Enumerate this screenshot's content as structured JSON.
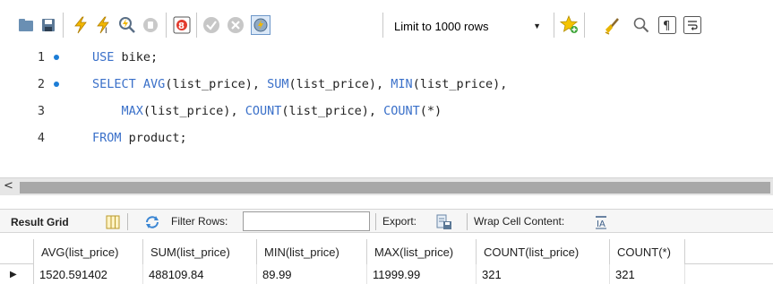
{
  "toolbar": {
    "icons": [
      "open-folder-icon",
      "save-icon",
      "execute-icon",
      "execute-current-icon",
      "explain-icon",
      "stop-icon",
      "toggle-error-icon",
      "commit-icon",
      "rollback-icon",
      "autocommit-icon",
      "bookmark-icon",
      "beautify-icon",
      "find-icon",
      "invisible-chars-icon",
      "wrap-icon"
    ],
    "limit_label": "Limit to 1000 rows",
    "accent_color": "#3a70c9"
  },
  "editor": {
    "lines": [
      {
        "number": "1",
        "marker": true,
        "parts": [
          {
            "t": "USE",
            "kw": true
          },
          {
            "t": " bike;",
            "kw": false
          }
        ]
      },
      {
        "number": "2",
        "marker": true,
        "parts": [
          {
            "t": "SELECT",
            "kw": true
          },
          {
            "t": " ",
            "kw": false
          },
          {
            "t": "AVG",
            "kw": true
          },
          {
            "t": "(list_price), ",
            "kw": false
          },
          {
            "t": "SUM",
            "kw": true
          },
          {
            "t": "(list_price), ",
            "kw": false
          },
          {
            "t": "MIN",
            "kw": true
          },
          {
            "t": "(list_price),",
            "kw": false
          }
        ]
      },
      {
        "number": "3",
        "marker": false,
        "parts": [
          {
            "t": "    ",
            "kw": false
          },
          {
            "t": "MAX",
            "kw": true
          },
          {
            "t": "(list_price), ",
            "kw": false
          },
          {
            "t": "COUNT",
            "kw": true
          },
          {
            "t": "(list_price), ",
            "kw": false
          },
          {
            "t": "COUNT",
            "kw": true
          },
          {
            "t": "(*)",
            "kw": false
          }
        ]
      },
      {
        "number": "4",
        "marker": false,
        "parts": [
          {
            "t": "FROM",
            "kw": true
          },
          {
            "t": " product;",
            "kw": false
          }
        ]
      }
    ]
  },
  "scrollbar": {
    "left_arrow": "<"
  },
  "result_bar": {
    "tab_label": "Result Grid",
    "filter_label": "Filter Rows:",
    "filter_value": "",
    "export_label": "Export:",
    "wrap_label": "Wrap Cell Content:"
  },
  "grid": {
    "columns": [
      "AVG(list_price)",
      "SUM(list_price)",
      "MIN(list_price)",
      "MAX(list_price)",
      "COUNT(list_price)",
      "COUNT(*)"
    ],
    "rows": [
      [
        "1520.591402",
        "488109.84",
        "89.99",
        "11999.99",
        "321",
        "321"
      ]
    ],
    "row_marker": "▶"
  }
}
